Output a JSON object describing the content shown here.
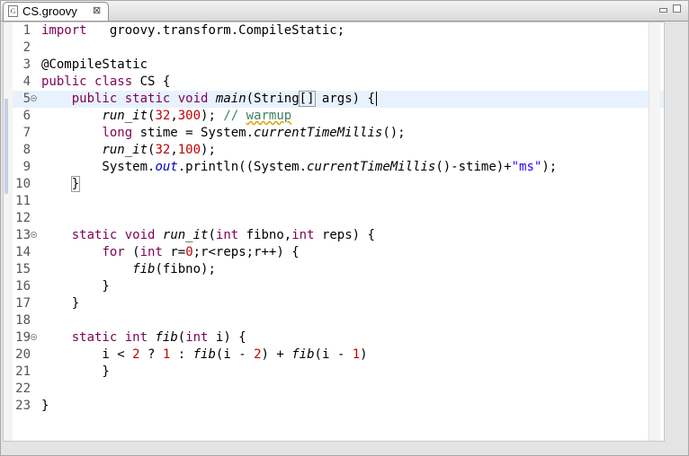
{
  "tab": {
    "title": "CS.groovy",
    "icon": "groovy-file-icon",
    "close": "⊠"
  },
  "lines": [
    {
      "n": "1",
      "fold": false,
      "current": false,
      "segs": [
        [
          "kw",
          "import"
        ],
        [
          "",
          "   groovy.transform.CompileStatic;"
        ]
      ]
    },
    {
      "n": "2",
      "fold": false,
      "current": false,
      "segs": []
    },
    {
      "n": "3",
      "fold": false,
      "current": false,
      "segs": [
        [
          "",
          "@CompileStatic"
        ]
      ]
    },
    {
      "n": "4",
      "fold": false,
      "current": false,
      "segs": [
        [
          "kw",
          "public"
        ],
        [
          "",
          " "
        ],
        [
          "kw",
          "class"
        ],
        [
          "",
          " CS {"
        ]
      ]
    },
    {
      "n": "5",
      "fold": true,
      "current": true,
      "segs": [
        [
          "",
          "    "
        ],
        [
          "kw",
          "public"
        ],
        [
          "",
          " "
        ],
        [
          "kw",
          "static"
        ],
        [
          "",
          " "
        ],
        [
          "kw",
          "void"
        ],
        [
          "",
          " "
        ],
        [
          "ital",
          "main"
        ],
        [
          "",
          "(String"
        ],
        [
          "box",
          "[]"
        ],
        [
          "",
          " args) {"
        ],
        [
          "caret",
          ""
        ]
      ]
    },
    {
      "n": "6",
      "fold": false,
      "current": false,
      "segs": [
        [
          "",
          "        "
        ],
        [
          "ital",
          "run_it"
        ],
        [
          "",
          "("
        ],
        [
          "num",
          "32"
        ],
        [
          "",
          ","
        ],
        [
          "num",
          "300"
        ],
        [
          "",
          "); "
        ],
        [
          "com",
          "// "
        ],
        [
          "com typo",
          "warmup"
        ]
      ]
    },
    {
      "n": "7",
      "fold": false,
      "current": false,
      "segs": [
        [
          "",
          "        "
        ],
        [
          "kw",
          "long"
        ],
        [
          "",
          " stime = System."
        ],
        [
          "ital",
          "currentTimeMillis"
        ],
        [
          "",
          "();"
        ]
      ]
    },
    {
      "n": "8",
      "fold": false,
      "current": false,
      "segs": [
        [
          "",
          "        "
        ],
        [
          "ital",
          "run_it"
        ],
        [
          "",
          "("
        ],
        [
          "num",
          "32"
        ],
        [
          "",
          ","
        ],
        [
          "num",
          "100"
        ],
        [
          "",
          ");"
        ]
      ]
    },
    {
      "n": "9",
      "fold": false,
      "current": false,
      "segs": [
        [
          "",
          "        System."
        ],
        [
          "fld",
          "out"
        ],
        [
          "",
          ".println((System."
        ],
        [
          "ital",
          "currentTimeMillis"
        ],
        [
          "",
          "()-stime)+"
        ],
        [
          "str",
          "\"ms\""
        ],
        [
          "",
          ");"
        ]
      ]
    },
    {
      "n": "10",
      "fold": false,
      "current": false,
      "segs": [
        [
          "",
          "    "
        ],
        [
          "box",
          "}"
        ]
      ]
    },
    {
      "n": "11",
      "fold": false,
      "current": false,
      "segs": []
    },
    {
      "n": "12",
      "fold": false,
      "current": false,
      "segs": []
    },
    {
      "n": "13",
      "fold": true,
      "current": false,
      "segs": [
        [
          "",
          "    "
        ],
        [
          "kw",
          "static"
        ],
        [
          "",
          " "
        ],
        [
          "kw",
          "void"
        ],
        [
          "",
          " "
        ],
        [
          "ital",
          "run_it"
        ],
        [
          "",
          "("
        ],
        [
          "kw",
          "int"
        ],
        [
          "",
          " fibno,"
        ],
        [
          "kw",
          "int"
        ],
        [
          "",
          " reps) {"
        ]
      ]
    },
    {
      "n": "14",
      "fold": false,
      "current": false,
      "segs": [
        [
          "",
          "        "
        ],
        [
          "kw",
          "for"
        ],
        [
          "",
          " ("
        ],
        [
          "kw",
          "int"
        ],
        [
          "",
          " r="
        ],
        [
          "num",
          "0"
        ],
        [
          "",
          ";r<reps;r++) {"
        ]
      ]
    },
    {
      "n": "15",
      "fold": false,
      "current": false,
      "segs": [
        [
          "",
          "            "
        ],
        [
          "ital",
          "fib"
        ],
        [
          "",
          "(fibno);"
        ]
      ]
    },
    {
      "n": "16",
      "fold": false,
      "current": false,
      "segs": [
        [
          "",
          "        }"
        ]
      ]
    },
    {
      "n": "17",
      "fold": false,
      "current": false,
      "segs": [
        [
          "",
          "    }"
        ]
      ]
    },
    {
      "n": "18",
      "fold": false,
      "current": false,
      "segs": []
    },
    {
      "n": "19",
      "fold": true,
      "current": false,
      "segs": [
        [
          "",
          "    "
        ],
        [
          "kw",
          "static"
        ],
        [
          "",
          " "
        ],
        [
          "kw",
          "int"
        ],
        [
          "",
          " "
        ],
        [
          "ital",
          "fib"
        ],
        [
          "",
          "("
        ],
        [
          "kw",
          "int"
        ],
        [
          "",
          " i) {"
        ]
      ]
    },
    {
      "n": "20",
      "fold": false,
      "current": false,
      "segs": [
        [
          "",
          "        i < "
        ],
        [
          "num",
          "2"
        ],
        [
          "",
          " ? "
        ],
        [
          "num",
          "1"
        ],
        [
          "",
          " : "
        ],
        [
          "ital",
          "fib"
        ],
        [
          "",
          "(i - "
        ],
        [
          "num",
          "2"
        ],
        [
          "",
          ") + "
        ],
        [
          "ital",
          "fib"
        ],
        [
          "",
          "(i - "
        ],
        [
          "num",
          "1"
        ],
        [
          "",
          ")"
        ]
      ]
    },
    {
      "n": "21",
      "fold": false,
      "current": false,
      "segs": [
        [
          "",
          "        }"
        ]
      ]
    },
    {
      "n": "22",
      "fold": false,
      "current": false,
      "segs": []
    },
    {
      "n": "23",
      "fold": false,
      "current": false,
      "segs": [
        [
          "",
          "}"
        ]
      ]
    }
  ]
}
